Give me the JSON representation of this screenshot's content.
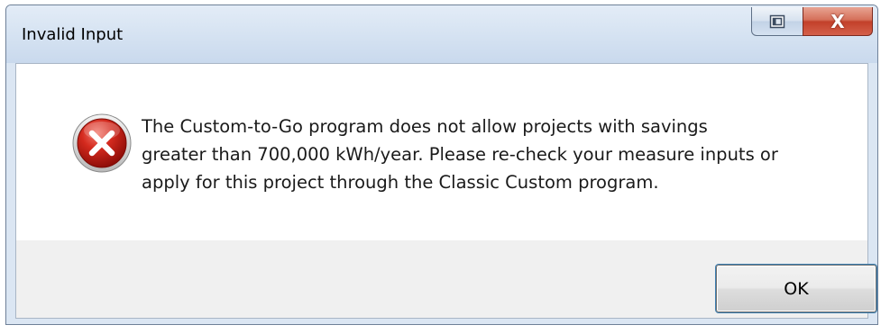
{
  "window": {
    "title": "Invalid Input",
    "restore_icon": "restore-window-icon",
    "close_icon": "close-icon",
    "close_glyph": "X"
  },
  "message": {
    "icon": "error-icon",
    "lines": [
      "The Custom-to-Go program does not allow projects with savings",
      "greater than 700,000 kWh/year. Please re-check your measure inputs or",
      "apply for this project through the Classic Custom program."
    ]
  },
  "buttons": {
    "ok_label": "OK"
  },
  "colors": {
    "error_red": "#d42a1e",
    "close_button_red": "#c2402a",
    "focus_border": "#3c7fb1"
  }
}
